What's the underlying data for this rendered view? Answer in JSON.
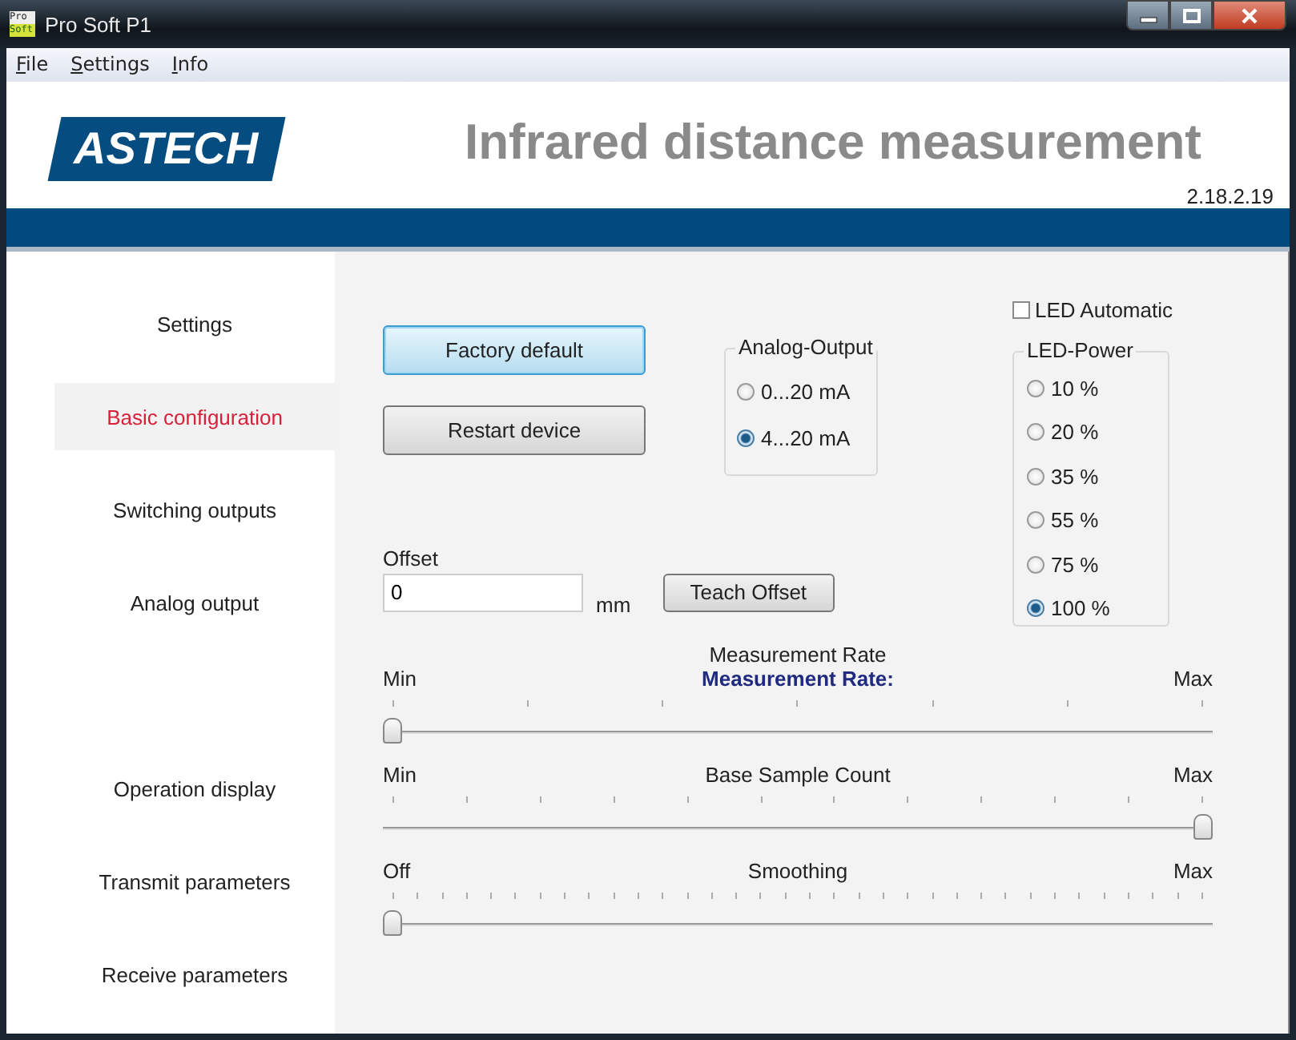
{
  "window": {
    "title": "Pro Soft P1",
    "icon_text": [
      "Pro",
      "Soft"
    ]
  },
  "menu": [
    "File",
    "Settings",
    "Info"
  ],
  "header": {
    "logo": "ASTECH",
    "title": "Infrared distance measurement",
    "version": "2.18.2.19"
  },
  "sidebar": {
    "groups": [
      {
        "items": [
          {
            "label": "Settings",
            "selected": false
          },
          {
            "label": "Basic configuration",
            "selected": true
          },
          {
            "label": "Switching outputs",
            "selected": false
          },
          {
            "label": "Analog output",
            "selected": false
          }
        ]
      },
      {
        "items": [
          {
            "label": "Operation display",
            "selected": false
          },
          {
            "label": "Transmit parameters",
            "selected": false
          },
          {
            "label": "Receive parameters",
            "selected": false
          }
        ]
      }
    ]
  },
  "buttons": [
    {
      "label": "Factory default",
      "focused": true
    },
    {
      "label": "Restart device",
      "focused": false
    }
  ],
  "analog_output": {
    "title": "Analog-Output",
    "options": [
      {
        "label": "0...20 mA",
        "selected": false
      },
      {
        "label": "4...20 mA",
        "selected": true
      }
    ]
  },
  "offset": {
    "label": "Offset",
    "value": "0",
    "unit": "mm",
    "button": "Teach Offset"
  },
  "led_automatic": {
    "label": "LED Automatic",
    "checked": false
  },
  "led_power": {
    "title": "LED-Power",
    "options": [
      {
        "label": "10 %",
        "selected": false
      },
      {
        "label": "20 %",
        "selected": false
      },
      {
        "label": "35 %",
        "selected": false
      },
      {
        "label": "55 %",
        "selected": false
      },
      {
        "label": "75 %",
        "selected": false
      },
      {
        "label": "100 %",
        "selected": true
      }
    ]
  },
  "sliders": [
    {
      "title": "Measurement Rate",
      "subtitle": "Measurement Rate:",
      "min": "Min",
      "max": "Max",
      "level": 0
    },
    {
      "title": "Base Sample Count",
      "min": "Min",
      "max": "Max",
      "level": 1
    },
    {
      "title": "Smoothing",
      "min": "Off",
      "max": "Max",
      "level": 0
    }
  ]
}
